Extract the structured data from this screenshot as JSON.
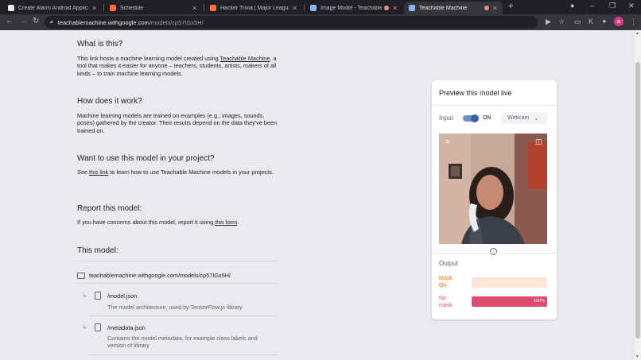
{
  "browser": {
    "tabs": [
      {
        "title": "Create Alarm Android Applicatio",
        "active": false
      },
      {
        "title": "Schedule",
        "active": false
      },
      {
        "title": "Hacker Trivia | Major League Hac",
        "active": false
      },
      {
        "title": "Image Model - Teachable M",
        "active": false
      },
      {
        "title": "Teachable Machine",
        "active": true
      }
    ],
    "url_host": "teachablemachine.withgoogle.com",
    "url_path": "/models/cp57IGx5H/",
    "avatar_initial": "a"
  },
  "content": {
    "what_heading": "What is this?",
    "what_text_1": "This link hosts a machine learning model created using ",
    "what_link": "Teachable Machine",
    "what_text_2": ", a tool that makes it easier for anyone – teachers, students, artists, makers of all kinds – to train machine learning models.",
    "how_heading": "How does it work?",
    "how_text": "Machine learning models are trained on examples (e.g., images, sounds, poses) gathered by the creator. Their results depend on the data they've been trained on.",
    "use_heading": "Want to use this model in your project?",
    "use_text_1": "See ",
    "use_link": "this link",
    "use_text_2": " to learn how to use Teachable Machine models in your projects.",
    "report_heading": "Report this model:",
    "report_text_1": "If you have concerns about this model, report it using ",
    "report_link": "this form",
    "report_text_2": ".",
    "model_heading": "This model:",
    "folder_url": "teachablemachine.withgoogle.com/models/cp57IGx5H/",
    "files": [
      {
        "name": "/model.json",
        "desc": "The model architecture, used by TensorFlow.js library"
      },
      {
        "name": "/metadata.json",
        "desc": "Contains the model metadata, for example class labels and version of library"
      }
    ]
  },
  "preview": {
    "title": "Preview this model live",
    "input_label": "Input",
    "toggle_state": "ON",
    "source": "Webcam",
    "output_label": "Output",
    "classes": [
      {
        "label_line1": "Mask",
        "label_line2": "On",
        "value": 0,
        "pct_text": "",
        "color": "#e8710a",
        "bg": "#fde6d8"
      },
      {
        "label_line1": "No",
        "label_line2": "mask",
        "value": 1.0,
        "pct_text": "100%",
        "color": "#dd4b6e",
        "bg": "#fbd9e2"
      }
    ]
  }
}
